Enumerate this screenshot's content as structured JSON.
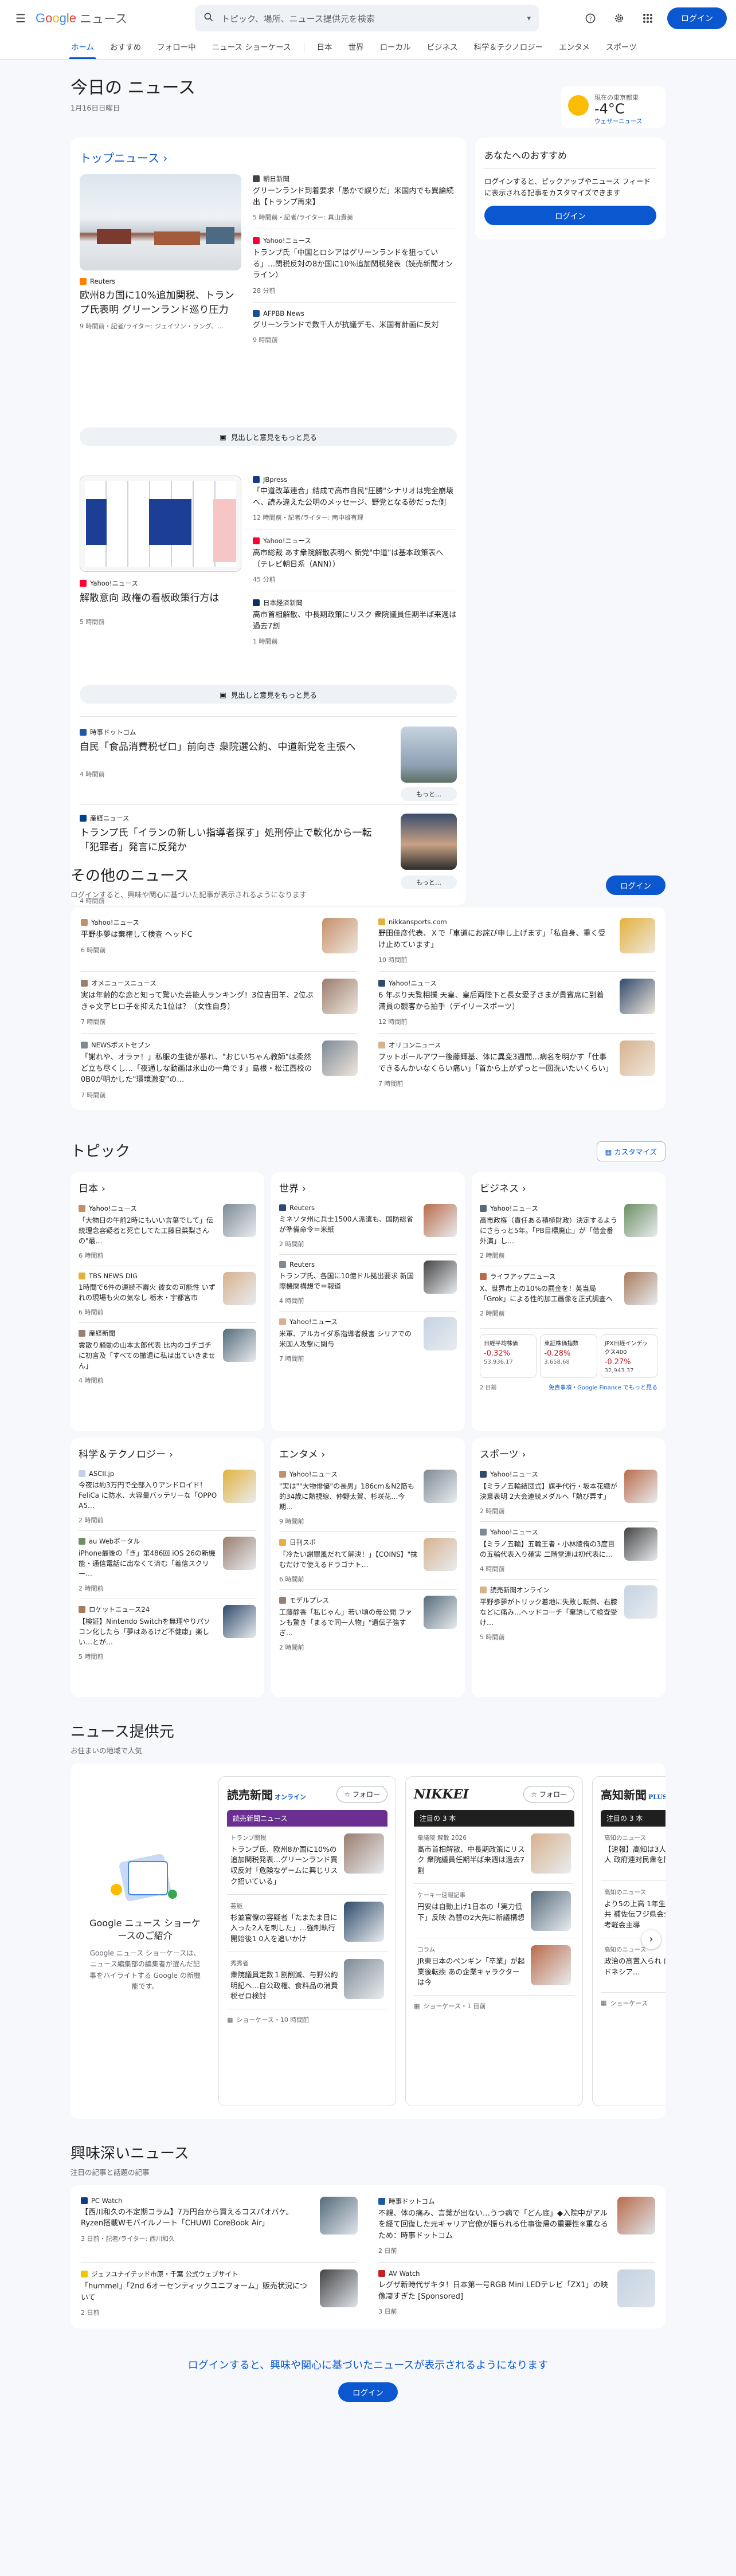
{
  "header": {
    "logo_text": "Google",
    "logo_suffix": "ニュース",
    "search_placeholder": "トピック、場所、ニュース提供元を検索",
    "login": "ログイン"
  },
  "nav": {
    "tabs": [
      "ホーム",
      "おすすめ",
      "フォロー中",
      "ニュース ショーケース"
    ],
    "tabs2": [
      "日本",
      "世界",
      "ローカル",
      "ビジネス",
      "科学＆テクノロジー",
      "エンタメ",
      "スポーツ"
    ]
  },
  "today": {
    "title": "今日の ニュース",
    "date": "1月16日日曜日"
  },
  "weather": {
    "place": "現在の東京都東",
    "temp": "-4°C",
    "provider": "ウェザーニュース"
  },
  "top": {
    "title": "トップニュース",
    "main1": {
      "source": "Reuters",
      "headline": "欧州8カ国に10%追加関税、トランプ氏表明 グリーンランド巡り圧力",
      "meta": "9 時間前・記者/ライター: ジェイソン・ラング、…"
    },
    "side1": [
      {
        "source": "朝日新聞",
        "headline": "グリーンランド到着要求「愚かで誤りだ」米国内でも異論続出【トランプ再来】",
        "meta": "5 時間前・記者/ライター: 真山貴美"
      },
      {
        "source": "Yahoo!ニュース",
        "headline": "トランプ氏「中国とロシアはグリーンランドを狙っている」…関税反対の8か国に10%追加関税発表（読売新聞オンライン）",
        "meta": "28 分前"
      },
      {
        "source": "AFPBB News",
        "headline": "グリーンランドで数千人が抗議デモ、米国有計画に反対",
        "meta": "9 時間前"
      }
    ],
    "more": "見出しと意見をもっと見る",
    "main2": {
      "source": "Yahoo!ニュース",
      "headline": "解散意向 政権の看板政策行方は",
      "meta": "5 時間前"
    },
    "side2": [
      {
        "source": "JBpress",
        "headline": "「中道改革連合」結成で高市自民\"圧勝\"シナリオは完全崩壊へ、読み違えた公明のメッセージ、野党となる砂だった側",
        "meta": "12 時間前・記者/ライター: 南中雄有理"
      },
      {
        "source": "Yahoo!ニュース",
        "headline": "高市総裁 あす衆院解散表明へ 新党\"中道\"は基本政策表へ（テレビ朝日系（ANN））",
        "meta": "45 分前"
      },
      {
        "source": "日本経済新聞",
        "headline": "高市首相解散、中長期政策にリスク 衆院議員任期半ば来週は過去7割",
        "meta": "1 時間前"
      }
    ],
    "solo": [
      {
        "source": "時事ドットコム",
        "headline": "自民「食品消費税ゼロ」前向き 衆院選公約、中道新党を主張へ",
        "meta": "4 時間前",
        "btn": "もっと…"
      },
      {
        "source": "産経ニュース",
        "headline": "トランプ氏「イランの新しい指導者探す」処刑停止で軟化から一転「犯罪者」発言に反発か",
        "meta": "4 時間前",
        "btn": "もっと…"
      }
    ]
  },
  "foryou": {
    "title": "あなたへのおすすめ",
    "desc": "ログインすると、ピックアップやニュース フィードに表示される記事をカスタマイズできます",
    "btn": "ログイン"
  },
  "other": {
    "title": "その他のニュース",
    "desc": "ログインすると、興味や関心に基づいた記事が表示されるようになります",
    "btn": "ログイン",
    "items": [
      {
        "source": "Yahoo!ニュース",
        "headline": "平野歩夢は棄権して検査 ヘッドC",
        "meta": "6 時間前"
      },
      {
        "source": "nikkansports.com",
        "headline": "野田佳彦代表、Ｘで「車道にお詫び申し上げます」「私自身、重く受け止めています」",
        "meta": "10 時間前"
      },
      {
        "source": "オメニュースニュース",
        "headline": "実は年齢的な恋と知って驚いた芸能人ランキング！3位吉田羊、2位ぶきゃ文字ヒロ子を抑えた1位は？（女性自身）",
        "meta": "7 時間前"
      },
      {
        "source": "Yahoo!ニュース",
        "headline": "6 年ぶり天覧相撲 天皇、皇后両陛下と長女愛子さまが貴賓席に到着 満員の観客から拍手（デイリースポーツ）",
        "meta": "12 時間前"
      },
      {
        "source": "NEWSポストセブン",
        "headline": "「謝れや、オラァ！」私服の生徒が暴れ、\"おじいちゃん教師\"は柔然ど立ち尽くし…「夜通しな動画は氷山の一角です」島根・松江西校の0B0が明かした\"環境激変\"の…",
        "meta": "7 時間前"
      },
      {
        "source": "オリコンニュース",
        "headline": "フットボールアワー後藤輝基、体に異変3週間…病名を明かす「仕事できるんかいなくらい痛い」「首から上がずっと一回洗いたいくらい」",
        "meta": "7 時間前"
      }
    ]
  },
  "topics": {
    "title": "トピック",
    "custom": "カスタマイズ",
    "cats": [
      {
        "name": "日本",
        "items": [
          {
            "source": "Yahoo!ニュース",
            "headline": "「大物日の午前2時にもいい言葉でして」伝統理念容疑者と死亡してた工藤日菜梨さんの\"最…",
            "meta": "6 時間前"
          },
          {
            "source": "TBS NEWS DIG",
            "headline": "1時間で6件の運続不審火 彼女の可能性 いずれの現場も火の気なし 栃木・宇都宮市",
            "meta": "6 時間前"
          },
          {
            "source": "産経新聞",
            "headline": "雲散り騒動の山本太郎代表 比内のゴチゴチに初言及「すべての撤退に私は出ていきません」",
            "meta": "4 時間前"
          }
        ]
      },
      {
        "name": "世界",
        "items": [
          {
            "source": "Reuters",
            "headline": "ミネソタ州に兵士1500人派遣も、国防総省が準備命令＝米紙",
            "meta": "2 時間前"
          },
          {
            "source": "Reuters",
            "headline": "トランプ氏、各国に10億ドル拠出要求 新国際機関構想で＝報道",
            "meta": "4 時間前"
          },
          {
            "source": "Yahoo!ニュース",
            "headline": "米軍、アルカイダ系指導者殺害 シリアでの米国人攻撃に関与",
            "meta": "7 時間前"
          }
        ]
      },
      {
        "name": "ビジネス",
        "items": [
          {
            "source": "Yahoo!ニュース",
            "headline": "高市政権（責任ある積極財政）決定するようにさらっと5年。「PB目標廃止」が「借金番外演」し…",
            "meta": "2 時間前"
          },
          {
            "source": "ライフアップニュース",
            "headline": "X、世界市上の10%の罰金を！英当局「Grok」による性的加工画像を正式調査へ",
            "meta": "2 時間前"
          }
        ],
        "stocks": [
          {
            "name": "日経平均株価",
            "chg": "-0.32%",
            "val": "53,936.17"
          },
          {
            "name": "東証株価指数",
            "chg": "-0.28%",
            "val": "3,658.68"
          },
          {
            "name": "JPX日経インデックス400",
            "chg": "-0.27%",
            "val": "32,943.37"
          }
        ],
        "stocks_meta": "2 日前",
        "stocks_link": "免責事項・Google Finance でもっと見る"
      },
      {
        "name": "科学＆テクノロジー",
        "items": [
          {
            "source": "ASCII.jp",
            "headline": "今夜は約3万円で全部入りアンドロイド！FeliCa に防水、大容量バッテリーな「OPPO A5…",
            "meta": "2 時間前"
          },
          {
            "source": "au Webポータル",
            "headline": "iPhone最後の「き」第486回 iOS 26の新機能・通信電話に出なくて済む「着信スクリー…",
            "meta": "2 時間前"
          },
          {
            "source": "ロケットニュース24",
            "headline": "【検証】Nintendo Switchを無理やりパソコン化したら「夢はあるけど不健康」楽しい…とが…",
            "meta": "5 時間前"
          }
        ]
      },
      {
        "name": "エンタメ",
        "items": [
          {
            "source": "Yahoo!ニュース",
            "headline": "\"実は\"\"大物俳優\"の長男」186cm＆N2筋も的34歳に熱視線、仲野太賀、杉咲花…今期…",
            "meta": "9 時間前"
          },
          {
            "source": "日刊スポ",
            "headline": "「冷たい謝罪風だれて解決！」【COINS】\"抹むだけで使えるドラゴナト…",
            "meta": "6 時間前"
          },
          {
            "source": "モデルプレス",
            "headline": "工藤静香「私じゃん」若い頃の母公開 ファンも驚き「まるで同一人物」\"遺伝子強すぎ…",
            "meta": "2 時間前"
          }
        ]
      },
      {
        "name": "スポーツ",
        "items": [
          {
            "source": "Yahoo!ニュース",
            "headline": "【ミラノ五輪結団式】旗手代行・坂本花織が決意表明 2大会連続メダルへ「熱び弄す」",
            "meta": "2 時間前"
          },
          {
            "source": "Yahoo!ニュース",
            "headline": "【ミラノ五輪】五輪王者・小林陵侑の3度目の五輪代表入り確実 二階堂連は初代表に…",
            "meta": "4 時間前"
          },
          {
            "source": "読売新聞オンライン",
            "headline": "平野歩夢がトリック着地に失敗し転倒、右膝などに痛み…ヘッドコーチ「棄誘して検査受け…",
            "meta": "5 時間前"
          }
        ]
      }
    ]
  },
  "providers": {
    "title": "ニュース提供元",
    "desc": "お住まいの地域で人気",
    "intro_title": "Google ニュース ショーケースのご紹介",
    "intro_text": "Google ニュース ショーケースは、ニュース編集部の編集者が選んだ記事をハイライトする Google の新機能です。",
    "pubs": [
      {
        "name": "読売新聞",
        "suffix": "オンライン",
        "follow": "フォロー",
        "banner": "読売新聞ニュース",
        "items": [
          {
            "cat": "トランプ関税",
            "headline": "トランプ氏、欧州8か国に10%の追加関税発表…グリーンランド買収反対「危険なゲームに興じリスク招いている」"
          },
          {
            "cat": "芸能",
            "headline": "杉並官僚の容疑者「たまたま目に入った2人を刺した」…強制執行開始後1 0人を追いかけ"
          },
          {
            "cat": "秀秀者",
            "headline": "衆院議員定数１割削減、与野公約明記へ…自公政権、食料品の消費税ゼロ検討"
          }
        ],
        "foot": "ショーケース・10 時間前"
      },
      {
        "name": "NIKKEI",
        "suffix": "",
        "follow": "フォロー",
        "banner": "注目の 3 本",
        "items": [
          {
            "cat": "衆議院 解散 2026",
            "headline": "高市首相解散、中長期政策にリスク 衆院議員任期半ば来週は過去7割"
          },
          {
            "cat": "ケーキー速報記事",
            "headline": "円安は自動上げ1日本の「実力低下」反映 為替の2大先に新議構想"
          },
          {
            "cat": "コラム",
            "headline": "JR東日本のペンギン「卒業」が起業後転換 あの企業キャラクターは今"
          }
        ],
        "foot": "ショーケース・1 日前"
      },
      {
        "name": "高知新聞",
        "suffix": "PLUS",
        "follow": "",
        "banner": "注目の 3 本",
        "items": [
          {
            "cat": "高知のニュース",
            "headline": "【速報】高知は3人主に高知1期7人 政府連対民衆を開設"
          },
          {
            "cat": "高知のニュース",
            "headline": "より5の上高 1年生主導！ 国学究共 補佐伝フジ県会全国極選賞買考軽会主導"
          },
          {
            "cat": "高知のニュース",
            "headline": "政治の高置入られ 内容1！ インドネシア…"
          }
        ],
        "foot": "ショーケース"
      }
    ]
  },
  "interesting": {
    "title": "興味深いニュース",
    "desc": "注目の記事と話題の記事",
    "items": [
      {
        "source": "PC Watch",
        "headline": "【西川和久の不定期コラム】「万円台から買えるコスパの",
        "headline2": "【西川和久の不定期コラム】7万円台から買えるコスパオバケ。Ryzen搭載Wモバイルノート「CHUWI CoreBook Air」",
        "meta": "3 日前・記者/ライター: 西川和久"
      },
      {
        "source": "時事ドットコム",
        "headline": "不親、体の痛み、言葉が出ない…うつ病で「どん底」◆入院中の介護福祉職員の…",
        "headline2": "不親、体の痛み、言葉が出ない…うつ病で「どん底」◆入院中がアルを経て回復した元キャリア官僚が振られる仕事復帰の重要性※重なるため：時事ドットコム",
        "meta": "2 日前"
      },
      {
        "source": "ジェフユナイテッド市原・千葉 公式ウェブサイト",
        "headline": "「hummel」「2nd 6オーセンティックユニフォーム」販売状況について",
        "meta": "2 日前"
      },
      {
        "source": "AV Watch",
        "headline": "レグザ新時代ザキタ！日本第一号RGB Mini LEDテレビ「ZX1」の映像凄すぎた [Sponsored]",
        "meta": "3 日前"
      }
    ]
  },
  "footer": {
    "text": "ログインすると、興味や関心に基づいたニュースが表示されるようになります",
    "btn": "ログイン"
  }
}
